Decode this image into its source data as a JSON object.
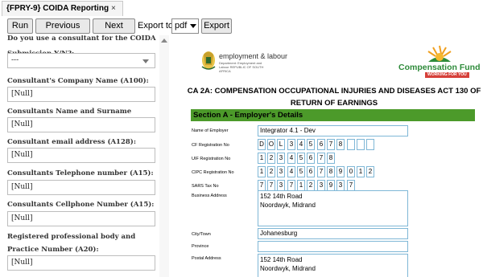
{
  "tab": {
    "title": "{FPRY-9} COIDA Reporting",
    "close": "×"
  },
  "toolbar": {
    "run": "Run",
    "previous_page": "Previous Page",
    "next_page": "Next Page",
    "export_to": "Export to:",
    "export_format": "pdf",
    "export": "Export"
  },
  "form": {
    "consultant_question": "Do you use a consultant for the COIDA Submission Y/N?:",
    "consultant_value": "---",
    "fields": [
      {
        "label": "Consultant's Company Name (A100):",
        "value": "[Null]"
      },
      {
        "label": "Consultants Name and Surname (A100):",
        "value": "[Null]"
      },
      {
        "label": "Consultant email address (A128):",
        "value": "[Null]"
      },
      {
        "label": "Consultants Telephone number (A15):",
        "value": "[Null]"
      },
      {
        "label": "Consultants Cellphone Number (A15):",
        "value": "[Null]"
      },
      {
        "label": "Registered professional body and Practice Number (A20):",
        "value": "[Null]"
      }
    ]
  },
  "doc": {
    "dol_name": "employment & labour",
    "dol_sub": "Department: Employment and Labour REPUBLIC OF SOUTH AFRICA",
    "cf_name": "Compensation Fund",
    "cf_tagline": "WORKING FOR YOU",
    "title": "CA 2A: COMPENSATION OCCUPATIONAL INJURIES AND DISEASES ACT 130 OF RETURN OF EARNINGS",
    "section_a": "Section A - Employer's Details",
    "rows": {
      "employer_label": "Name of Employer",
      "employer_value": "Integrator 4.1 - Dev",
      "cf_label": "CF Registration No",
      "cf_digits": [
        "D",
        "O",
        "L",
        "3",
        "4",
        "5",
        "6",
        "7",
        "8",
        "",
        "",
        ""
      ],
      "uif_label": "UIF Registration No",
      "uif_digits": [
        "1",
        "2",
        "3",
        "4",
        "5",
        "6",
        "7",
        "8"
      ],
      "cipc_label": "CIPC Registration No",
      "cipc_digits": [
        "1",
        "2",
        "3",
        "4",
        "5",
        "6",
        "7",
        "8",
        "9",
        "0",
        "1",
        "2"
      ],
      "sars_label": "SARS Tax No",
      "sars_digits": [
        "7",
        "7",
        "3",
        "7",
        "1",
        "2",
        "3",
        "9",
        "3",
        "7"
      ],
      "business_label": "Business Address",
      "business_line1": "152 14th Road",
      "business_line2": "Noordwyk, Midrand",
      "city_label": "City/Town",
      "city_value": "Johanesburg",
      "province_label": "Province",
      "province_value": "",
      "postal_label": "Postal Address",
      "postal_line1": "152 14th Road",
      "postal_line2": "Noordwyk, Midrand"
    }
  }
}
